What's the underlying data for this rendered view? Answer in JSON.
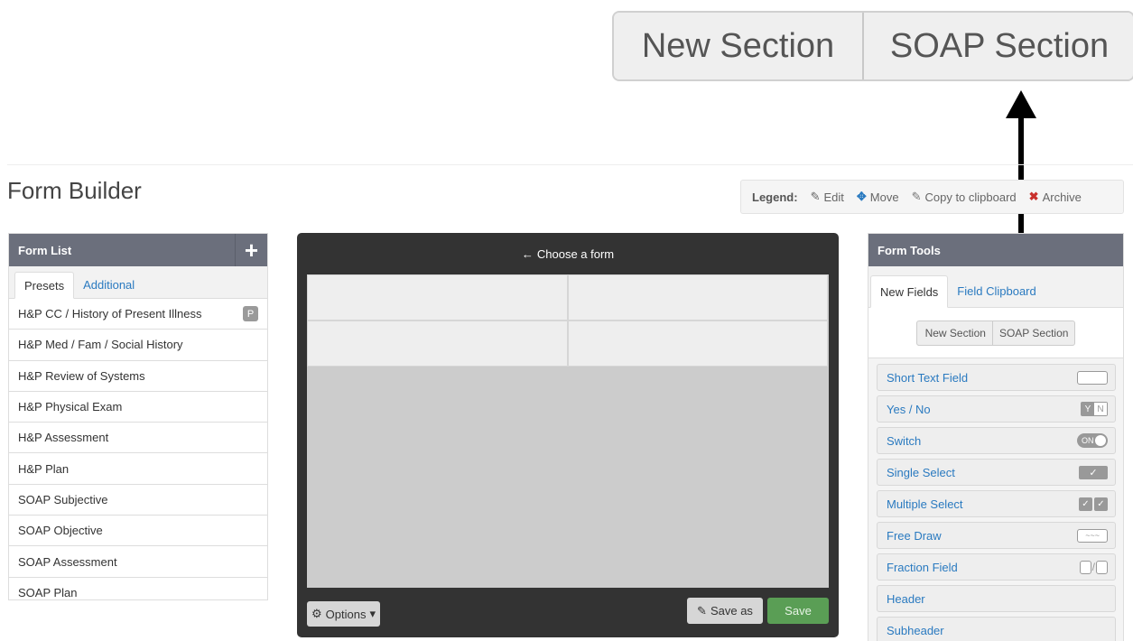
{
  "callout": {
    "left_label": "New Section",
    "right_label": "SOAP Section"
  },
  "page": {
    "title": "Form Builder"
  },
  "legend": {
    "label": "Legend:",
    "edit": "Edit",
    "move": "Move",
    "copy": "Copy to clipboard",
    "archive": "Archive",
    "edit_icon": "✎",
    "move_icon": "✥",
    "copy_icon": "✎",
    "archive_icon": "✖"
  },
  "form_list": {
    "title": "Form List",
    "add_icon": "+",
    "tabs": [
      "Presets",
      "Additional"
    ],
    "items": [
      {
        "label": "H&P CC / History of Present Illness",
        "badge": "P"
      },
      {
        "label": "H&P Med / Fam / Social History"
      },
      {
        "label": "H&P Review of Systems"
      },
      {
        "label": "H&P Physical Exam"
      },
      {
        "label": "H&P Assessment"
      },
      {
        "label": "H&P Plan"
      },
      {
        "label": "SOAP Subjective"
      },
      {
        "label": "SOAP Objective"
      },
      {
        "label": "SOAP Assessment"
      },
      {
        "label": "SOAP Plan"
      }
    ]
  },
  "canvas": {
    "title": "Choose a form",
    "back_icon": "←",
    "options_label": "Options",
    "options_icon": "⚙",
    "caret": "▾",
    "save_as_label": "Save as",
    "save_as_icon": "✎",
    "save_label": "Save"
  },
  "form_tools": {
    "title": "Form Tools",
    "tabs": [
      "New Fields",
      "Field Clipboard"
    ],
    "section_buttons": [
      "New Section",
      "SOAP Section"
    ],
    "fields": [
      {
        "label": "Short Text Field",
        "icon": "text-box-icon"
      },
      {
        "label": "Yes / No",
        "icon": "yes-no-icon"
      },
      {
        "label": "Switch",
        "icon": "switch-icon"
      },
      {
        "label": "Single Select",
        "icon": "single-check-icon"
      },
      {
        "label": "Multiple Select",
        "icon": "multi-check-icon"
      },
      {
        "label": "Free Draw",
        "icon": "free-draw-icon"
      },
      {
        "label": "Fraction Field",
        "icon": "fraction-icon"
      },
      {
        "label": "Header",
        "icon": ""
      },
      {
        "label": "Subheader",
        "icon": ""
      }
    ],
    "icon_text": {
      "y": "Y",
      "n": "N",
      "on": "ON",
      "check": "✓",
      "slash": "/",
      "draw": "~~~"
    }
  }
}
